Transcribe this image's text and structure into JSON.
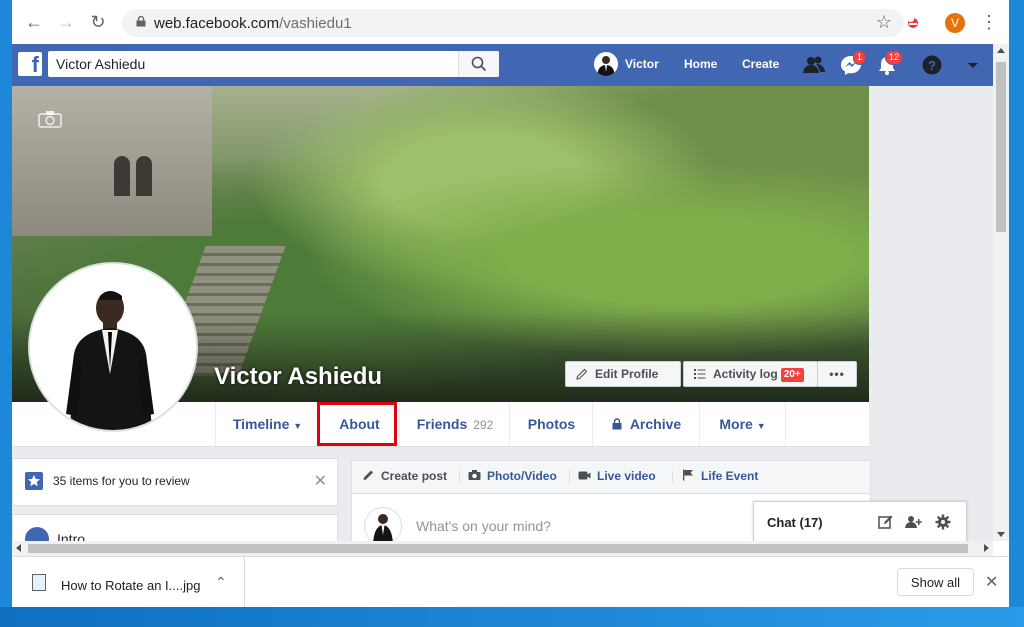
{
  "browser": {
    "url_host": "web.facebook.com",
    "url_path": "/vashiedu1",
    "profile_initial": "V"
  },
  "fbbar": {
    "search_value": "Victor Ashiedu",
    "user_name": "Victor",
    "links": {
      "home": "Home",
      "create": "Create"
    },
    "messages_badge": "1",
    "notifications_badge": "12"
  },
  "profile": {
    "name": "Victor Ashiedu",
    "edit_profile": "Edit Profile",
    "activity_log": "Activity log",
    "activity_badge": "20+"
  },
  "tabs": {
    "timeline": "Timeline",
    "about": "About",
    "friends": "Friends",
    "friends_count": "292",
    "photos": "Photos",
    "archive": "Archive",
    "more": "More"
  },
  "sidebar": {
    "review_text": "35 items for you to review",
    "intro": "Intro"
  },
  "composer": {
    "create_post": "Create post",
    "photo_video": "Photo/Video",
    "live_video": "Live video",
    "life_event": "Life Event",
    "placeholder": "What's on your mind?"
  },
  "chat": {
    "label": "Chat (17)"
  },
  "downloads": {
    "file_name": "How to Rotate an I....jpg",
    "show_all": "Show all"
  },
  "colors": {
    "fb_blue": "#4267b2",
    "link_blue": "#365899",
    "highlight_red": "#e0000f",
    "badge_red": "#fa3e3e"
  }
}
